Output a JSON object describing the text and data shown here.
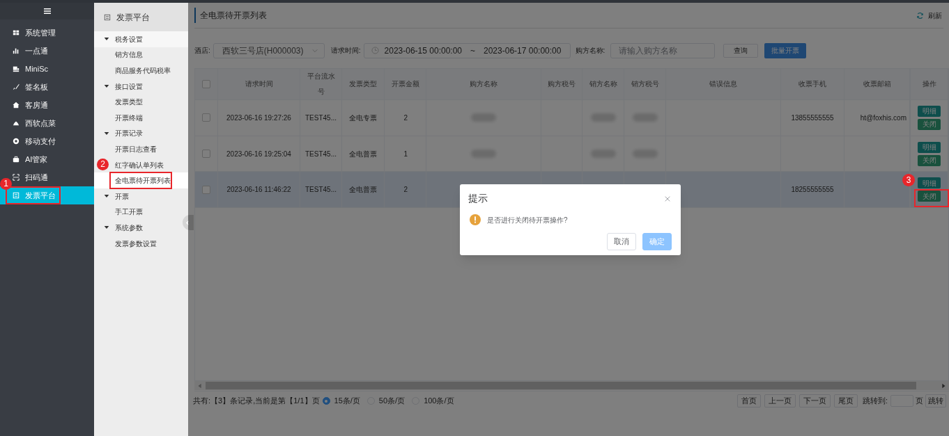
{
  "sidebar": {
    "items": [
      {
        "label": "系统管理",
        "selected": false
      },
      {
        "label": "一点通",
        "selected": false
      },
      {
        "label": "MiniSc",
        "selected": false
      },
      {
        "label": "签名板",
        "selected": false
      },
      {
        "label": "客房通",
        "selected": false
      },
      {
        "label": "西软点菜",
        "selected": false
      },
      {
        "label": "移动支付",
        "selected": false
      },
      {
        "label": "AI管家",
        "selected": false
      },
      {
        "label": "扫码通",
        "selected": false
      },
      {
        "label": "发票平台",
        "selected": true,
        "callout": "1"
      }
    ]
  },
  "subnav": {
    "title": "发票平台",
    "groups": [
      {
        "label": "税务设置",
        "expanded": true,
        "children": [
          {
            "label": "销方信息",
            "selected": false
          },
          {
            "label": "商品服务代码税率",
            "selected": false
          }
        ]
      },
      {
        "label": "接口设置",
        "expanded": true,
        "children": [
          {
            "label": "发票类型",
            "selected": false
          },
          {
            "label": "开票终端",
            "selected": false
          }
        ]
      },
      {
        "label": "开票记录",
        "expanded": true,
        "children": [
          {
            "label": "开票日志查看",
            "selected": false
          },
          {
            "label": "红字确认单列表",
            "selected": false
          },
          {
            "label": "全电票待开票列表",
            "selected": true,
            "callout": "2"
          }
        ]
      },
      {
        "label": "开票",
        "expanded": true,
        "children": [
          {
            "label": "手工开票",
            "selected": false
          }
        ]
      },
      {
        "label": "系统参数",
        "expanded": true,
        "children": [
          {
            "label": "发票参数设置",
            "selected": false
          }
        ]
      }
    ]
  },
  "main": {
    "title": "全电票待开票列表",
    "refresh": "刷新",
    "filters": {
      "hotel_label": "酒店:",
      "hotel_value": "西软三号店(H000003)",
      "time_label": "请求时间:",
      "time_start": "2023-06-15 00:00:00",
      "time_separator": "~",
      "time_end": "2023-06-17 00:00:00",
      "buyer_label": "购方名称:",
      "buyer_placeholder": "请输入购方名称",
      "query_button": "查询",
      "batch_button": "批量开票"
    },
    "table": {
      "header_checked": false,
      "columns": [
        "请求时间",
        "平台流水号",
        "发票类型",
        "开票金额",
        "购方名称",
        "购方税号",
        "销方名称",
        "销方税号",
        "错误信息",
        "收票手机",
        "收票邮箱",
        "操作"
      ],
      "rows": [
        {
          "checked": false,
          "selected": false,
          "cells": [
            {
              "kind": "text",
              "text": "2023-06-16 19:27:26"
            },
            {
              "kind": "text",
              "text": "TEST45..."
            },
            {
              "kind": "text",
              "text": "全电专票"
            },
            {
              "kind": "text",
              "text": "2"
            },
            {
              "kind": "blurred"
            },
            {
              "kind": "empty"
            },
            {
              "kind": "blurred"
            },
            {
              "kind": "blurred"
            },
            {
              "kind": "empty"
            },
            {
              "kind": "text",
              "text": "13855555555"
            },
            {
              "kind": "text",
              "text": "ht@foxhis.com"
            }
          ],
          "actions": [
            {
              "label": "明细"
            },
            {
              "label": "关闭"
            }
          ]
        },
        {
          "checked": false,
          "selected": false,
          "cells": [
            {
              "kind": "text",
              "text": "2023-06-16 19:25:04"
            },
            {
              "kind": "text",
              "text": "TEST45..."
            },
            {
              "kind": "text",
              "text": "全电普票"
            },
            {
              "kind": "text",
              "text": "1"
            },
            {
              "kind": "blurred"
            },
            {
              "kind": "empty"
            },
            {
              "kind": "blurred"
            },
            {
              "kind": "blurred"
            },
            {
              "kind": "empty"
            },
            {
              "kind": "empty"
            },
            {
              "kind": "empty"
            }
          ],
          "actions": [
            {
              "label": "明细"
            },
            {
              "label": "关闭"
            }
          ]
        },
        {
          "checked": false,
          "selected": true,
          "cells": [
            {
              "kind": "text",
              "text": "2023-06-16 11:46:22"
            },
            {
              "kind": "text",
              "text": "TEST45..."
            },
            {
              "kind": "text",
              "text": "全电普票"
            },
            {
              "kind": "text",
              "text": "2"
            },
            {
              "kind": "empty"
            },
            {
              "kind": "empty"
            },
            {
              "kind": "empty"
            },
            {
              "kind": "empty"
            },
            {
              "kind": "empty"
            },
            {
              "kind": "text",
              "text": "18255555555"
            },
            {
              "kind": "empty"
            }
          ],
          "actions": [
            {
              "label": "明细"
            },
            {
              "label": "关闭",
              "callout": "3"
            }
          ]
        }
      ]
    },
    "pagination": {
      "summary": "共有:【3】条记录,当前是第【1/1】页",
      "page_sizes": [
        {
          "label": "15条/页",
          "selected": true
        },
        {
          "label": "50条/页",
          "selected": false
        },
        {
          "label": "100条/页",
          "selected": false
        }
      ],
      "buttons": [
        "首页",
        "上一页",
        "下一页",
        "尾页"
      ],
      "jump_label": "跳转到:",
      "jump_unit": "页",
      "jump_button": "跳转"
    }
  },
  "dialog": {
    "title": "提示",
    "message": "是否进行关闭待开票操作?",
    "buttons": [
      {
        "label": "取消",
        "kind": "plain"
      },
      {
        "label": "确定",
        "kind": "primary"
      }
    ]
  }
}
